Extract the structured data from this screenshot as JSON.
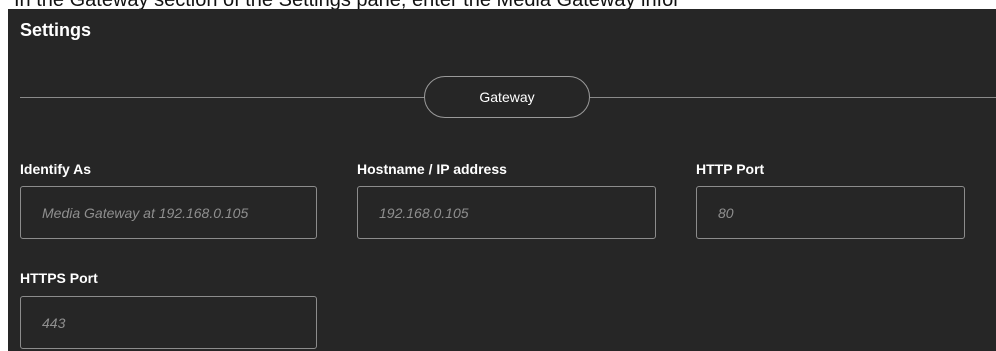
{
  "instruction_text": "In the Gateway section of the Settings pane, enter the Media Gateway infor",
  "settings": {
    "title": "Settings",
    "section_label": "Gateway",
    "fields": {
      "identify_as": {
        "label": "Identify As",
        "placeholder": "Media Gateway at 192.168.0.105"
      },
      "hostname": {
        "label": "Hostname / IP address",
        "placeholder": "192.168.0.105"
      },
      "http_port": {
        "label": "HTTP Port",
        "placeholder": "80"
      },
      "https_port": {
        "label": "HTTPS Port",
        "placeholder": "443"
      }
    }
  }
}
